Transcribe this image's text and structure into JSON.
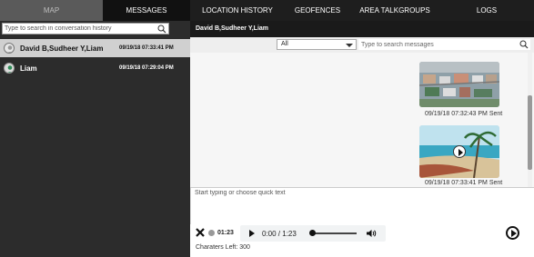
{
  "nav": {
    "tabs": [
      {
        "label": "MAP"
      },
      {
        "label": "MESSAGES"
      },
      {
        "label": "LOCATION HISTORY"
      },
      {
        "label": "GEOFENCES"
      },
      {
        "label": "AREA TALKGROUPS"
      },
      {
        "label": "LOGS"
      }
    ],
    "active_tab": "MESSAGES"
  },
  "conversations": {
    "search_placeholder": "Type to search in conversation history",
    "items": [
      {
        "name": "David B,Sudheer Y,Liam",
        "time": "09/19/18 07:33:41 PM",
        "selected": true
      },
      {
        "name": "Liam",
        "time": "09/19/18 07:29:04 PM",
        "selected": false
      }
    ]
  },
  "thread": {
    "header": "David B,Sudheer Y,Liam",
    "filter": {
      "selected": "All"
    },
    "search_placeholder": "Type to search messages",
    "messages": [
      {
        "type": "image",
        "timestamp": "09/19/18 07:32:43 PM Sent",
        "subject": "aerial city view"
      },
      {
        "type": "video",
        "timestamp": "09/19/18 07:33:41 PM Sent",
        "subject": "beach with palm trees"
      }
    ]
  },
  "composer": {
    "placeholder": "Start typing or choose quick text",
    "recording_time": "01:23",
    "audio_time": "0:00 / 1:23",
    "chars_left": "Charaters Left: 300"
  },
  "colors": {
    "nav_bg": "#1e1e1e",
    "left_panel_bg": "#2c2c2c",
    "selected_row_bg": "#d0d0d0",
    "thread_bg": "#f6f6f6"
  }
}
